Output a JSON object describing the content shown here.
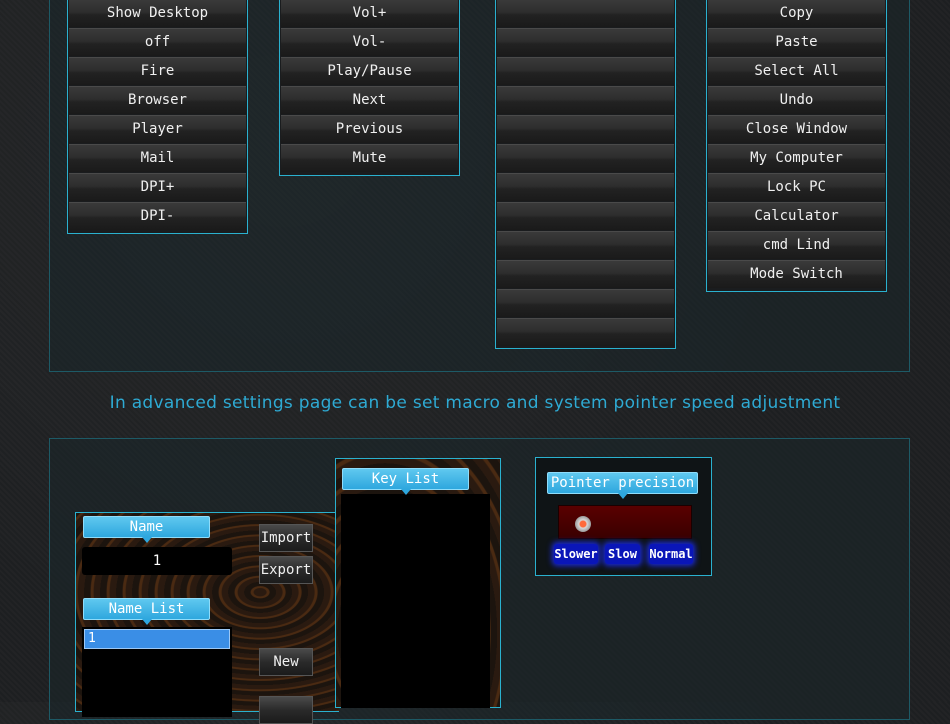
{
  "menus": {
    "col1": [
      "Show Desktop",
      "off",
      "Fire",
      "Browser",
      "Player",
      "Mail",
      "DPI+",
      "DPI-"
    ],
    "col2": [
      "Vol+",
      "Vol-",
      "Play/Pause",
      "Next",
      "Previous",
      "Mute"
    ],
    "col3": [
      "",
      "",
      "",
      "",
      "",
      "",
      "",
      "",
      "",
      "",
      "",
      ""
    ],
    "col4": [
      "Copy",
      "Paste",
      "Select All",
      "Undo",
      "Close Window",
      "My Computer",
      "Lock PC",
      "Calculator",
      "cmd Lind",
      "Mode Switch"
    ]
  },
  "caption": "In advanced settings page can be set macro and system pointer speed adjustment",
  "macro": {
    "name_label": "Name",
    "name_value": "1",
    "name_list_label": "Name List",
    "name_list_items": [
      "1"
    ],
    "key_list_label": "Key List",
    "import_label": "Import",
    "export_label": "Export",
    "new_label": "New"
  },
  "pointer": {
    "title": "Pointer precision",
    "speeds": [
      "Slower",
      "Slow",
      "Normal"
    ],
    "level": 0
  },
  "colors": {
    "accent": "#2ab1cf",
    "caption": "#2eaad3",
    "badge": "#2ea7de",
    "selection": "#3a8ee6"
  }
}
